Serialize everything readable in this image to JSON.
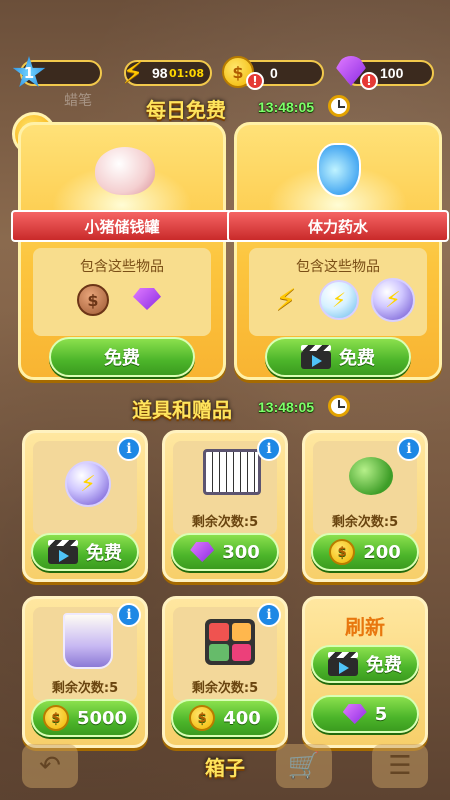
{
  "status": {
    "level": "1",
    "energy": "98",
    "energy_timer": "01:08",
    "coins": "0",
    "gems": "100"
  },
  "background": {
    "label_1": "蜡笔"
  },
  "daily": {
    "title": "每日免费",
    "timer": "13:48:05",
    "cards": [
      {
        "name": "小猪储钱罐",
        "contents_label": "包含这些物品",
        "button": "免费"
      },
      {
        "name": "体力药水",
        "contents_label": "包含这些物品",
        "button": "免费"
      }
    ]
  },
  "shop": {
    "title": "道具和赠品",
    "timer": "13:48:05",
    "items": [
      {
        "icon": "energy-orb-icon",
        "remaining": "",
        "price": "免费",
        "currency": "video"
      },
      {
        "icon": "puzzle-board-icon",
        "remaining": "剩余次数:5",
        "price": "300",
        "currency": "gem"
      },
      {
        "icon": "clover-icon",
        "remaining": "剩余次数:5",
        "price": "200",
        "currency": "coin"
      },
      {
        "icon": "glass-cup-icon",
        "remaining": "剩余次数:5",
        "price": "5000",
        "currency": "coin"
      },
      {
        "icon": "color-blocks-icon",
        "remaining": "剩余次数:5",
        "price": "400",
        "currency": "coin"
      }
    ],
    "refresh": {
      "title": "刷新",
      "free_button": "免费",
      "gem_button": "5"
    }
  },
  "bottom": {
    "title": "箱子"
  },
  "colors": {
    "accent_yellow": "#ffe45c",
    "timer_green": "#7dff6a",
    "button_green": "#4cb52a",
    "ribbon_red": "#c92a2a"
  }
}
